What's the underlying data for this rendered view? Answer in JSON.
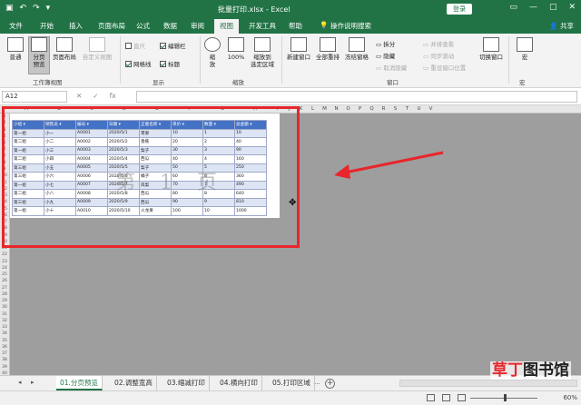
{
  "titlebar": {
    "title": "批量打印.xlsx  -  Excel",
    "login": "登录",
    "undo": "↶",
    "redo": "↷",
    "save": "▣",
    "qa_more": "▾",
    "win_min": "—",
    "win_max": "▢",
    "win_close": "✕",
    "ribbon_opt": "▭"
  },
  "menu": {
    "tabs": [
      "文件",
      "开始",
      "插入",
      "页面布局",
      "公式",
      "数据",
      "审阅",
      "视图",
      "开发工具",
      "帮助"
    ],
    "active": "视图",
    "tell": "操作说明搜索",
    "share": "共享"
  },
  "ribbon": {
    "normal": "普通",
    "pagebreak": "分页\n预览",
    "pagelayout": "页面布局",
    "custom": "自定义视图",
    "ruler": "直尺",
    "gridlines": "网格线",
    "formulabar": "编辑栏",
    "headings": "标题",
    "zoom": "缩\n放",
    "zoom100": "100%",
    "zoomsel": "缩放到\n选定区域",
    "newwin": "新建窗口",
    "arrange": "全部重排",
    "freeze": "冻结窗格",
    "split": "拆分",
    "hide": "隐藏",
    "unhide": "取消隐藏",
    "sidebyside": "并排查看",
    "syncscroll": "同步滚动",
    "resetpos": "重设窗口位置",
    "switchwin": "切换窗口",
    "macro": "宏",
    "group_workbookview": "工作簿视图",
    "group_show": "显示",
    "group_zoom": "缩放",
    "group_window": "窗口",
    "group_macro": "宏"
  },
  "formulabar": {
    "namebox": "A12",
    "cancel": "✕",
    "enter": "✓",
    "fx": "fx"
  },
  "sheet": {
    "columns": [
      "A",
      "B",
      "C",
      "D",
      "E",
      "F",
      "G",
      "H",
      "I",
      "J",
      "K",
      "L",
      "M",
      "N",
      "O",
      "P",
      "Q",
      "R",
      "S",
      "T",
      "U",
      "V"
    ],
    "rows": [
      "1",
      "2",
      "3",
      "4",
      "5",
      "6",
      "7",
      "8",
      "9",
      "10",
      "11",
      "12",
      "13",
      "14",
      "15",
      "16",
      "17",
      "18",
      "19",
      "20",
      "21",
      "22",
      "23",
      "24",
      "25",
      "26",
      "27",
      "28",
      "29",
      "30",
      "31",
      "32",
      "33",
      "34",
      "35",
      "36",
      "37",
      "38",
      "39",
      "40"
    ],
    "watermark": "第 1 页",
    "headers": [
      "小组",
      "销售员",
      "编号",
      "日期",
      "正版名称",
      "单价",
      "数量",
      "总金额"
    ],
    "table": [
      [
        "第一组",
        "小一",
        "A0001",
        "2020/5/1",
        "苹果",
        "10",
        "1",
        "10"
      ],
      [
        "第二组",
        "小二",
        "A0002",
        "2020/5/2",
        "香蕉",
        "20",
        "2",
        "40"
      ],
      [
        "第一组",
        "小三",
        "A0003",
        "2020/5/3",
        "梨子",
        "30",
        "3",
        "90"
      ],
      [
        "第二组",
        "小四",
        "A0004",
        "2020/5/4",
        "西瓜",
        "40",
        "4",
        "160"
      ],
      [
        "第三组",
        "小五",
        "A0005",
        "2020/5/5",
        "梨子",
        "50",
        "5",
        "250"
      ],
      [
        "第三组",
        "小六",
        "A0006",
        "2020/5/6",
        "橘子",
        "60",
        "6",
        "360"
      ],
      [
        "第一组",
        "小七",
        "A0007",
        "2020/5/7",
        "凤梨",
        "70",
        "7",
        "490"
      ],
      [
        "第二组",
        "小八",
        "A0008",
        "2020/5/8",
        "西瓜",
        "80",
        "8",
        "640"
      ],
      [
        "第三组",
        "小九",
        "A0009",
        "2020/5/9",
        "西瓜",
        "90",
        "9",
        "810"
      ],
      [
        "第一组",
        "小十",
        "A0010",
        "2020/5/10",
        "火龙果",
        "100",
        "10",
        "1000"
      ]
    ]
  },
  "sheettabs": [
    "01.分页预览",
    "02.调整宽高",
    "03.缩减打印",
    "04.横向打印",
    "05.打印区域"
  ],
  "sheettab_more": "...",
  "sheettab_nav": {
    "prev": "◂",
    "next": "▸"
  },
  "add_sheet": "+",
  "zoom": "60%",
  "watermark_logo": {
    "part1": "草丁",
    "part2": "图书馆"
  },
  "colors": {
    "excel_green": "#217346",
    "annotation_red": "#e8262c",
    "header_blue": "#4472c4"
  }
}
